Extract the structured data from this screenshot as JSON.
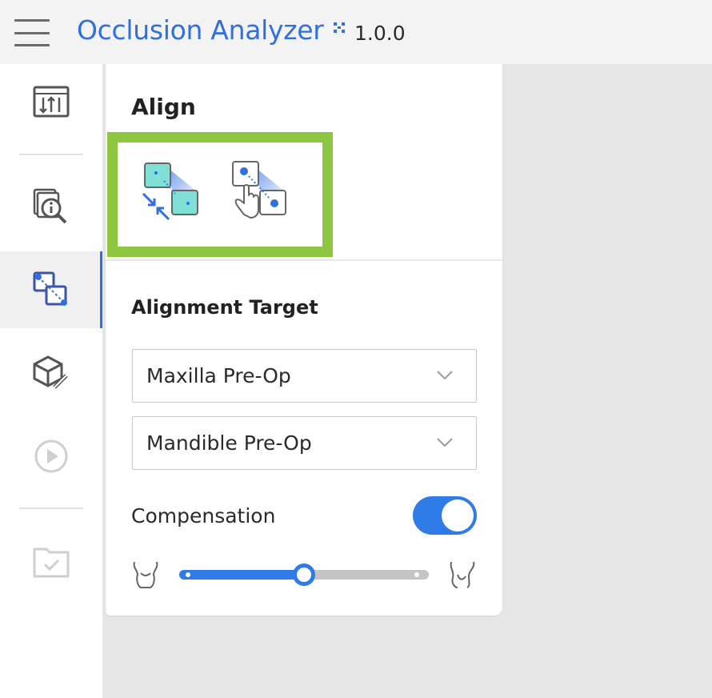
{
  "header": {
    "title": "Occlusion Analyzer",
    "version": "1.0.0"
  },
  "rail": {
    "items": [
      {
        "icon": "compare-report-icon",
        "active": false
      },
      {
        "icon": "case-info-icon",
        "active": false
      },
      {
        "icon": "align-icon",
        "active": true
      },
      {
        "icon": "model-edit-icon",
        "active": false
      },
      {
        "icon": "play-icon",
        "active": false,
        "disabled": true
      },
      {
        "icon": "folder-check-icon",
        "active": false,
        "disabled": true
      }
    ]
  },
  "panel": {
    "title": "Align",
    "tools": [
      {
        "icon": "auto-align-icon"
      },
      {
        "icon": "manual-point-align-icon"
      }
    ],
    "alignment_target_label": "Alignment Target",
    "select_1_value": "Maxilla Pre-Op",
    "select_2_value": "Mandible Pre-Op",
    "compensation_label": "Compensation",
    "compensation_on": true,
    "compensation_slider_fraction": 0.5
  },
  "colors": {
    "accent": "#2f6fe0",
    "toggle": "#2f7be8",
    "highlight": "#8dc641"
  }
}
